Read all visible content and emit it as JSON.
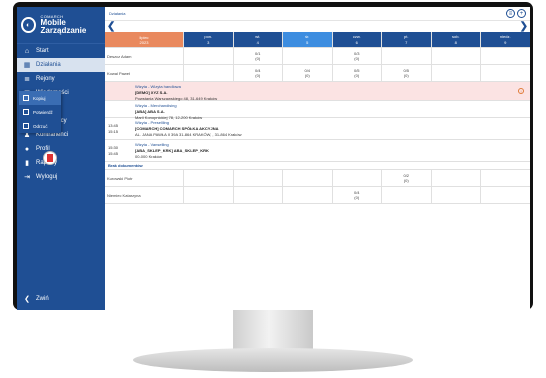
{
  "app": {
    "brand": "COMARCH",
    "name": "Mobile Zarządzanie"
  },
  "nav": {
    "items": [
      {
        "icon": "home-icon",
        "glyph": "⌂",
        "label": "Start"
      },
      {
        "icon": "calendar-icon",
        "glyph": "▦",
        "label": "Działania"
      },
      {
        "icon": "regions-icon",
        "glyph": "≣",
        "label": "Rejony"
      },
      {
        "icon": "messages-icon",
        "glyph": "✉",
        "label": "Wiadomości"
      },
      {
        "icon": "car-icon",
        "glyph": "▬",
        "label": "Trasy"
      },
      {
        "icon": "employees-icon",
        "glyph": "☻",
        "label": "Pracownicy"
      },
      {
        "icon": "contractors-icon",
        "glyph": "♟",
        "label": "Kontrahenci"
      },
      {
        "icon": "profile-icon",
        "glyph": "●",
        "label": "Profil"
      },
      {
        "icon": "reports-icon",
        "glyph": "▮",
        "label": "Raporty"
      },
      {
        "icon": "logout-icon",
        "glyph": "⇥",
        "label": "Wyloguj"
      }
    ],
    "close_label": "Zwiń"
  },
  "breadcrumb": "Działania",
  "calendar": {
    "first_col": {
      "label": "lipiec",
      "sub": "2023"
    },
    "days": [
      {
        "name": "pon.",
        "num": "3"
      },
      {
        "name": "wt.",
        "num": "4"
      },
      {
        "name": "śr.",
        "num": "5"
      },
      {
        "name": "czw.",
        "num": "6"
      },
      {
        "name": "pt.",
        "num": "7"
      },
      {
        "name": "sob.",
        "num": "8"
      },
      {
        "name": "niedz.",
        "num": "9"
      }
    ],
    "rows": [
      {
        "name": "Deszcz Adam",
        "cells": [
          "",
          "0/1\n(0)",
          "",
          "0/3\n(0)",
          "",
          "",
          ""
        ]
      },
      {
        "name": "Kowal Paweł",
        "cells": [
          "",
          "0/4\n(0)",
          "0/4\n(0)",
          "0/5\n(0)",
          "0/5\n(0)",
          "",
          ""
        ]
      }
    ],
    "visits": [
      {
        "time": "",
        "title": "Wizyta - Wizyta handlowa",
        "company": "[DEMO] XYZ S.A.",
        "address": "Powstania Warszawskiego 48, 31-649 Kraków",
        "warn": "!"
      },
      {
        "time": "",
        "title": "Wizyta - Merchandising",
        "company": "[ABA] ABA S.A.",
        "address": "Marii Konopnickiej 78, 12-200 Kraków",
        "warn": ""
      },
      {
        "time": "13:45\n15:15",
        "title": "Wizyta - Presellling",
        "company": "[COMARCH] COMARCH SPÓŁKA AKCYJNA",
        "address": "AL. JANA PAWŁA II 39A 31-864 KRAKÓW, , 31-864 Kraków",
        "warn": ""
      },
      {
        "time": "15:30\n15:45",
        "title": "Wizyta - Vanselling",
        "company": "[ABA_SKLEP_KRK] ABA_SKLEP_KRK",
        "address": "00-000 Kraków",
        "warn": ""
      }
    ],
    "no_docs": "Brak dokumentów",
    "rows_bottom": [
      {
        "name": "Kurowski Piotr",
        "cells": [
          "",
          "",
          "",
          "",
          "0/2\n(0)",
          "",
          ""
        ]
      },
      {
        "name": "Niemiec Katarzyna",
        "cells": [
          "",
          "",
          "",
          "0/4\n(0)",
          "",
          "",
          ""
        ]
      }
    ]
  },
  "context_menu": [
    {
      "icon": "copy-icon",
      "label": "Kopiuj"
    },
    {
      "icon": "confirm-icon",
      "label": "Potwierdź"
    },
    {
      "icon": "reject-icon",
      "label": "Odrzuć"
    }
  ]
}
